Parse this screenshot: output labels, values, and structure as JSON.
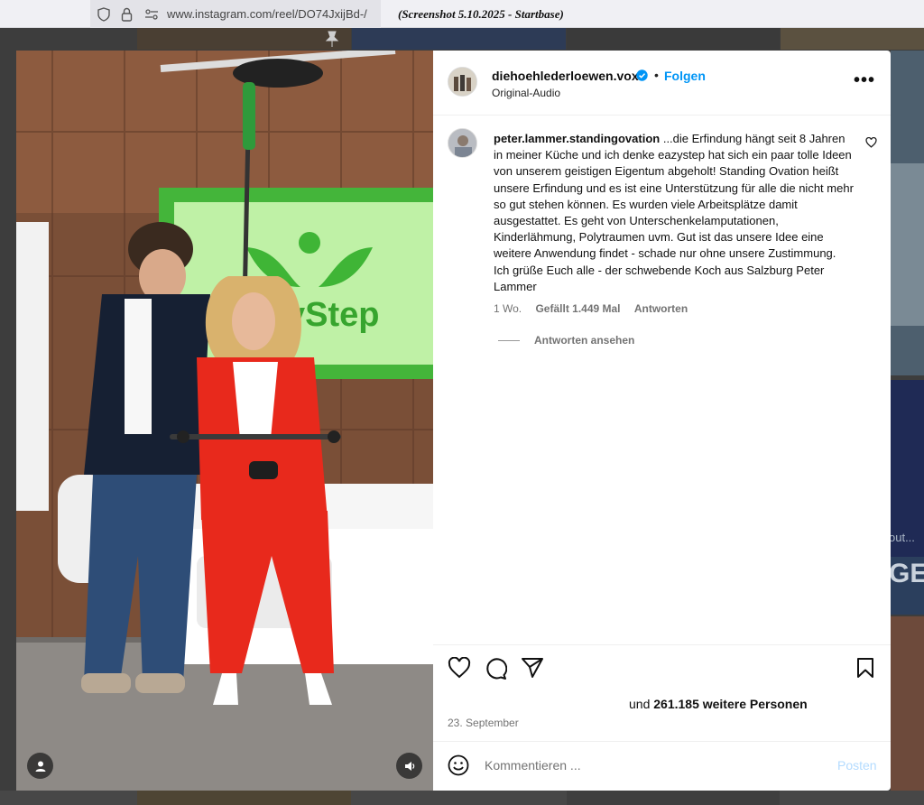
{
  "browser": {
    "url": "www.instagram.com/reel/DO74JxijBd-/",
    "annotation": "(Screenshot 5.10.2025 - Startbase)"
  },
  "post": {
    "username": "diehoehlederloewen.vox",
    "separator": "•",
    "follow_label": "Folgen",
    "audio_label": "Original-Audio",
    "more_label": "•••"
  },
  "comment": {
    "username": "peter.lammer.standingovation",
    "text": " ...die Erfindung hängt seit 8 Jahren in meiner Küche und ich denke eazystep hat sich ein paar tolle Ideen von unserem geistigen Eigentum abgeholt! Standing Ovation heißt unsere Erfindung und es ist eine Unterstützung für alle die nicht mehr so gut stehen können. Es wurden viele Arbeitsplätze damit ausgestattet. Es geht von Unterschenkelamputationen, Kinderlähmung, Polytraumen uvm. Gut ist das unsere Idee eine weitere Anwendung findet - schade nur ohne unsere Zustimmung. Ich grüße Euch alle - der schwebende Koch aus Salzburg Peter Lammer",
    "age": "1 Wo.",
    "likes": "Gefällt 1.449 Mal",
    "reply_label": "Antworten",
    "view_replies": "Antworten ansehen"
  },
  "footer": {
    "likes_prefix": "und ",
    "likes_count": "261.185 weitere Personen",
    "date": "23. September",
    "comment_placeholder": "Kommentieren ...",
    "post_label": "Posten"
  },
  "video": {
    "screen_text": "zyStep"
  },
  "background": {
    "partial_text_1": "out...",
    "partial_text_2": "GE"
  },
  "colors": {
    "accent": "#0095f6",
    "verified": "#0095f6",
    "suit": "#e8291c"
  }
}
